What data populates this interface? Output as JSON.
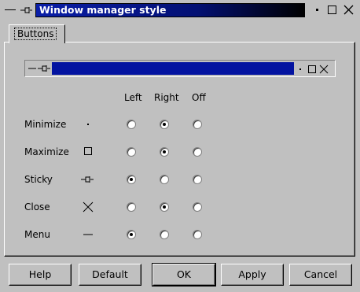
{
  "window": {
    "title": "Window manager style"
  },
  "tabs": [
    {
      "label": "Buttons"
    }
  ],
  "columns": [
    "Left",
    "Right",
    "Off"
  ],
  "rows": [
    {
      "label": "Minimize",
      "icon": "dot-icon",
      "selected": "Right"
    },
    {
      "label": "Maximize",
      "icon": "square-icon",
      "selected": "Right"
    },
    {
      "label": "Sticky",
      "icon": "pin-icon",
      "selected": "Left"
    },
    {
      "label": "Close",
      "icon": "x-icon",
      "selected": "Right"
    },
    {
      "label": "Menu",
      "icon": "dash-icon",
      "selected": "Left"
    }
  ],
  "buttons": {
    "help": "Help",
    "default": "Default",
    "ok": "OK",
    "apply": "Apply",
    "cancel": "Cancel"
  },
  "colors": {
    "title_bar": "#0313a0",
    "face": "#c0c0c0"
  }
}
